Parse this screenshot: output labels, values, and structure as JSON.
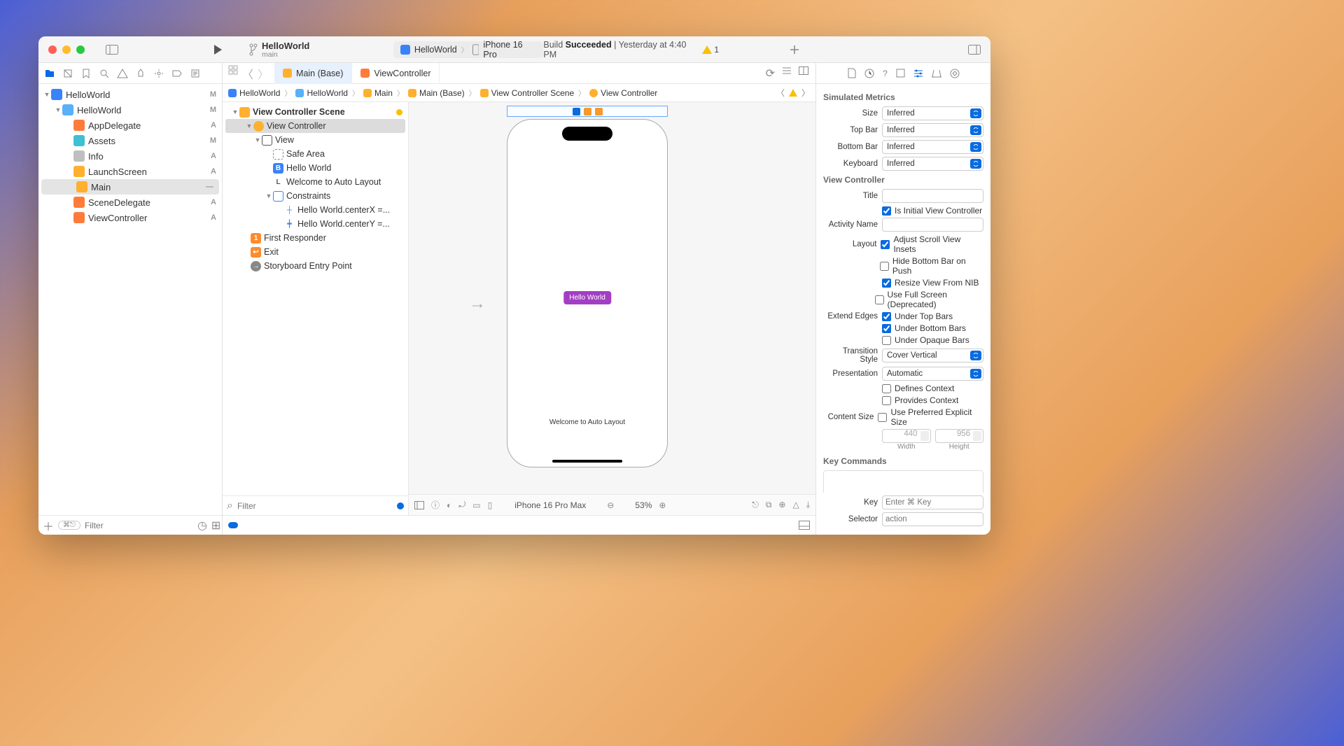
{
  "titlebar": {
    "project": "HelloWorld",
    "branch": "main",
    "scheme": "HelloWorld",
    "destination": "iPhone 16 Pro",
    "build_status_prefix": "Build ",
    "build_status_bold": "Succeeded",
    "build_status_suffix": " | Yesterday at 4:40 PM",
    "warning_count": "1"
  },
  "navigator": {
    "root": "HelloWorld",
    "root_badge": "M",
    "group": "HelloWorld",
    "group_badge": "M",
    "files": [
      {
        "name": "AppDelegate",
        "badge": "A",
        "type": "swift"
      },
      {
        "name": "Assets",
        "badge": "M",
        "type": "assets"
      },
      {
        "name": "Info",
        "badge": "A",
        "type": "plist"
      },
      {
        "name": "LaunchScreen",
        "badge": "A",
        "type": "story"
      },
      {
        "name": "Main",
        "badge": "—",
        "type": "story",
        "selected": true
      },
      {
        "name": "SceneDelegate",
        "badge": "A",
        "type": "swift"
      },
      {
        "name": "ViewController",
        "badge": "A",
        "type": "swift"
      }
    ],
    "filter_placeholder": "Filter"
  },
  "tabs": {
    "active": "Main (Base)",
    "other": "ViewController"
  },
  "jumpbar": [
    "HelloWorld",
    "HelloWorld",
    "Main",
    "Main (Base)",
    "View Controller Scene",
    "View Controller"
  ],
  "outline": {
    "scene": "View Controller Scene",
    "vc": "View Controller",
    "view": "View",
    "safe": "Safe Area",
    "button": "Hello World",
    "label": "Welcome to Auto Layout",
    "constraints": "Constraints",
    "c1": "Hello World.centerX =...",
    "c2": "Hello World.centerY =...",
    "firstResponder": "First Responder",
    "exit": "Exit",
    "entry": "Storyboard Entry Point",
    "filter_placeholder": "Filter"
  },
  "canvas": {
    "button_text": "Hello World",
    "label_text": "Welcome to Auto Layout",
    "device": "iPhone 16 Pro Max",
    "zoom": "53%"
  },
  "inspector": {
    "sim_header": "Simulated Metrics",
    "size_label": "Size",
    "size_value": "Inferred",
    "topbar_label": "Top Bar",
    "topbar_value": "Inferred",
    "bottombar_label": "Bottom Bar",
    "bottombar_value": "Inferred",
    "keyboard_label": "Keyboard",
    "keyboard_value": "Inferred",
    "vc_header": "View Controller",
    "title_label": "Title",
    "is_initial": "Is Initial View Controller",
    "activity_label": "Activity Name",
    "layout_label": "Layout",
    "adjust_insets": "Adjust Scroll View Insets",
    "hide_bottom": "Hide Bottom Bar on Push",
    "resize_nib": "Resize View From NIB",
    "full_screen": "Use Full Screen (Deprecated)",
    "extend_label": "Extend Edges",
    "under_top": "Under Top Bars",
    "under_bottom": "Under Bottom Bars",
    "under_opaque": "Under Opaque Bars",
    "transition_label": "Transition Style",
    "transition_value": "Cover Vertical",
    "presentation_label": "Presentation",
    "presentation_value": "Automatic",
    "defines_ctx": "Defines Context",
    "provides_ctx": "Provides Context",
    "content_size_label": "Content Size",
    "use_explicit": "Use Preferred Explicit Size",
    "width": "440",
    "height": "956",
    "width_label": "Width",
    "height_label": "Height",
    "keycmd_header": "Key Commands",
    "key_label": "Key",
    "key_placeholder": "Enter ⌘ Key",
    "selector_label": "Selector",
    "selector_placeholder": "action"
  }
}
